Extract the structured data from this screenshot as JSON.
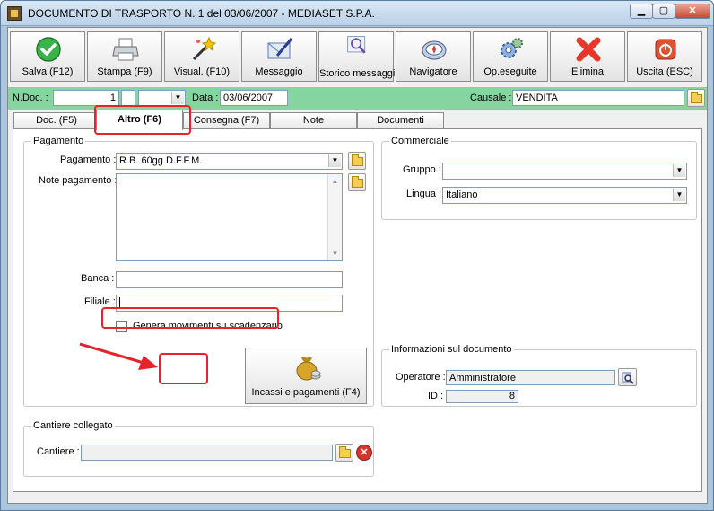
{
  "window": {
    "title": "DOCUMENTO DI TRASPORTO N. 1  del 03/06/2007 - MEDIASET S.P.A."
  },
  "toolbar": [
    {
      "label": "Salva (F12)",
      "icon": "check-icon"
    },
    {
      "label": "Stampa (F9)",
      "icon": "printer-icon"
    },
    {
      "label": "Visual. (F10)",
      "icon": "magic-wand-icon"
    },
    {
      "label": "Messaggio",
      "icon": "message-pen-icon"
    },
    {
      "label": "Storico messaggi",
      "icon": "message-history-icon"
    },
    {
      "label": "Navigatore",
      "icon": "compass-icon"
    },
    {
      "label": "Op.eseguite",
      "icon": "gears-icon"
    },
    {
      "label": "Elimina",
      "icon": "delete-x-icon"
    },
    {
      "label": "Uscita (ESC)",
      "icon": "exit-icon"
    }
  ],
  "header": {
    "ndoc_label": "N.Doc. :",
    "ndoc_value": "1",
    "data_label": "Data :",
    "data_value": "03/06/2007",
    "causale_label": "Causale :",
    "causale_value": "VENDITA"
  },
  "tabs": [
    "Doc. (F5)",
    "Altro (F6)",
    "Consegna (F7)",
    "Note",
    "Documenti"
  ],
  "active_tab": "Altro (F6)",
  "pagamento": {
    "legend": "Pagamento",
    "pagamento_label": "Pagamento :",
    "pagamento_value": "R.B. 60gg D.F.F.M.",
    "note_label": "Note pagamento :",
    "banca_label": "Banca :",
    "filiale_label": "Filiale :",
    "checkbox_label": "Genera movimenti su scadenzario",
    "incassi_label": "Incassi e pagamenti (F4)"
  },
  "commerciale": {
    "legend": "Commerciale",
    "gruppo_label": "Gruppo :",
    "lingua_label": "Lingua :",
    "lingua_value": "Italiano"
  },
  "info": {
    "legend": "Informazioni sul documento",
    "operatore_label": "Operatore :",
    "operatore_value": "Amministratore",
    "id_label": "ID :",
    "id_value": "8"
  },
  "cantiere": {
    "legend": "Cantiere collegato",
    "cantiere_label": "Cantiere :"
  },
  "colors": {
    "header_strip": "#86d4a0",
    "annotation_red": "#e8222a"
  }
}
